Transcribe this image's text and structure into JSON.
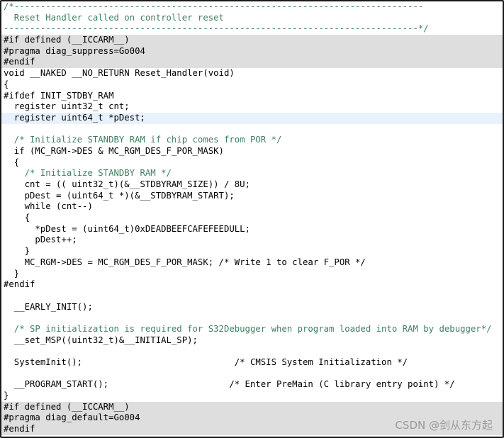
{
  "editor": {
    "lines": [
      {
        "text": "/*------------------------------------------------------------------------------"
      },
      {
        "text": "  Reset Handler called on controller reset"
      },
      {
        "text": "-------------------------------------------------------------------------------*/"
      },
      {
        "text": "#if defined (__ICCARM__)"
      },
      {
        "text": "#pragma diag_suppress=Go004"
      },
      {
        "text": "#endif"
      },
      {
        "text": "void __NAKED __NO_RETURN Reset_Handler(void)"
      },
      {
        "text": "{"
      },
      {
        "text": "#ifdef INIT_STDBY_RAM"
      },
      {
        "text": "  register uint32_t cnt;"
      },
      {
        "text": "  register uint64_t *pDest;"
      },
      {
        "text": ""
      },
      {
        "text": "  /* Initialize STANDBY RAM if chip comes from POR */"
      },
      {
        "text": "  if (MC_RGM->DES & MC_RGM_DES_F_POR_MASK)"
      },
      {
        "text": "  {"
      },
      {
        "text": "    /* Initialize STANDBY RAM */"
      },
      {
        "text": "    cnt = (( uint32_t)(&__STDBYRAM_SIZE)) / 8U;"
      },
      {
        "text": "    pDest = (uint64_t *)(&__STDBYRAM_START);"
      },
      {
        "text": "    while (cnt--)"
      },
      {
        "text": "    {"
      },
      {
        "text": "      *pDest = (uint64_t)0xDEADBEEFCAFEFEEDULL;"
      },
      {
        "text": "      pDest++;"
      },
      {
        "text": "    }"
      },
      {
        "text": "    MC_RGM->DES = MC_RGM_DES_F_POR_MASK; /* Write 1 to clear F_POR */"
      },
      {
        "text": "  }"
      },
      {
        "text": "#endif"
      },
      {
        "text": ""
      },
      {
        "text": "  __EARLY_INIT();"
      },
      {
        "text": ""
      },
      {
        "text": "  /* SP initialization is required for S32Debugger when program loaded into RAM by debugger*/"
      },
      {
        "text": "  __set_MSP((uint32_t)&__INITIAL_SP);"
      },
      {
        "text": ""
      },
      {
        "text": "  SystemInit();                             /* CMSIS System Initialization */"
      },
      {
        "text": ""
      },
      {
        "text": "  __PROGRAM_START();                       /* Enter PreMain (C library entry point) */"
      },
      {
        "text": "}"
      },
      {
        "text": "#if defined (__ICCARM__)"
      },
      {
        "text": "#pragma diag_default=Go004"
      },
      {
        "text": "#endif"
      }
    ]
  },
  "watermark": "CSDN @剑从东方起",
  "colors": {
    "comment": "#3f7f5f",
    "keyword": "#7f0055",
    "type": "#005032",
    "field": "#0000c0",
    "preprocessor_background": "#dedede",
    "current_line": "#e8f2fe"
  }
}
